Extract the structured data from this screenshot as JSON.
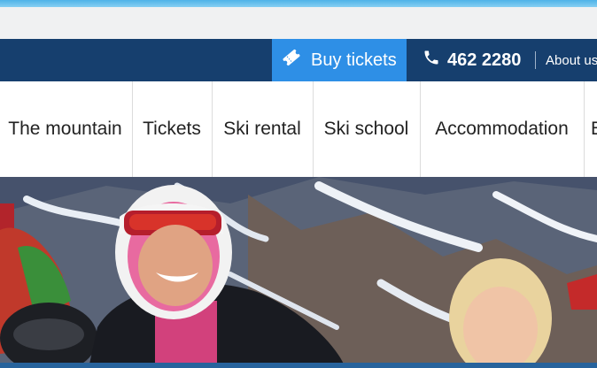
{
  "utility": {
    "buy_tickets": "Buy tickets",
    "phone": "462 2280",
    "about": "About us"
  },
  "nav": {
    "items": [
      "The mountain",
      "Tickets",
      "Ski rental",
      "Ski school",
      "Accommodation",
      "E"
    ]
  },
  "colors": {
    "utility_bar": "#163f6e",
    "buy_button": "#2e8fe6",
    "top_strip": "#58b8ea"
  },
  "icons": [
    "ticket-icon",
    "phone-icon"
  ]
}
